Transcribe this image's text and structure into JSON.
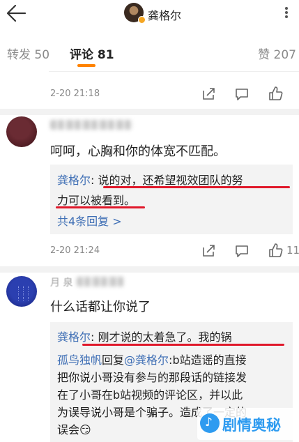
{
  "header": {
    "title": "龚格尔",
    "back_icon": "arrow-left-icon",
    "more_icon": "more-dots-icon"
  },
  "tabs": [
    {
      "label": "转发 50",
      "active": false
    },
    {
      "label": "评论 81",
      "active": true
    },
    {
      "label": "赞 207",
      "active": false
    }
  ],
  "top_item": {
    "time": "2-20 21:18",
    "like_count": ""
  },
  "comment_a": {
    "text": "呵呵，心胸和你的体宽不匹配。",
    "reply_name": "龚格尔",
    "reply_line1": ": 说的对，还希望视效团队的努",
    "reply_line2": "力可以被看到。",
    "more_replies": "共4条回复 >",
    "time": "2-20 21:24",
    "like_count": "11"
  },
  "comment_b": {
    "username_partial": "月 泉",
    "text": "什么话都让你说了",
    "reply1_name": "龚格尔",
    "reply1_text": ": 刚才说的太着急了。我的锅",
    "reply2_name": "孤鸟独帆",
    "reply2_mid": "回复",
    "reply2_at": "@龚格尔",
    "reply2_line1": ":b站造谣的直接",
    "reply2_line2": "把你说小哥没有参与的那段话的链接发",
    "reply2_line3": "在了小哥在b站视频的评论区，并以此",
    "reply2_line4": "为误导说小哥是个骗子。造成了一定的",
    "reply2_line5": "误会😏"
  },
  "watermark": {
    "text": "剧情奥秘",
    "logo": "♪"
  },
  "colors": {
    "accent_orange": "#ff8200",
    "link_blue": "#3f6fb5",
    "annotation_red": "#e0182a",
    "watermark_blue": "#2e9bf0"
  }
}
